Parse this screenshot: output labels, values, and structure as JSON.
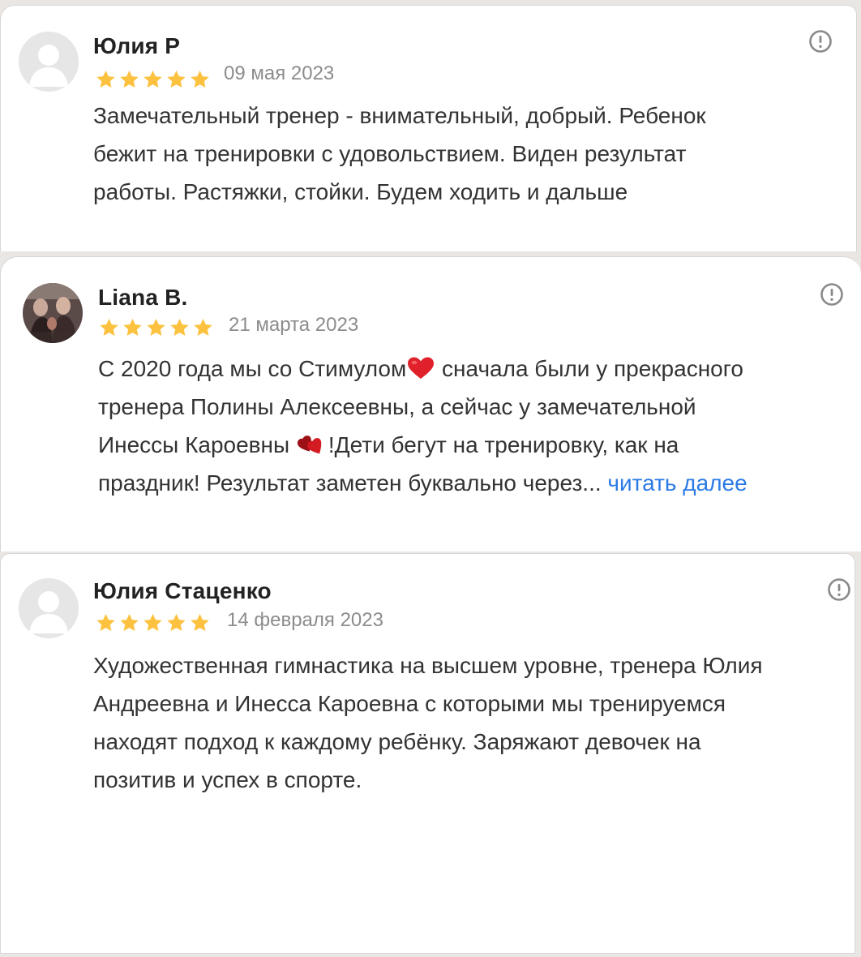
{
  "reviews": [
    {
      "author": "Юлия Р",
      "avatar": "default-avatar-icon",
      "rating": 5,
      "date": "09 мая 2023",
      "text_lines": [
        "Замечательный тренер - внимательный, добрый. Ребенок",
        "бежит на тренировки с удовольствием. Виден результат",
        "работы. Растяжки, стойки. Будем ходить и дальше"
      ]
    },
    {
      "author": "Liana B.",
      "avatar": "user-photo-avatar",
      "rating": 5,
      "date": "21 марта 2023",
      "text_lines": [
        "С 2020 года мы со Стимулом",
        " сначала были у прекрасного",
        "тренера Полины Алексеевны, а сейчас у замечательной",
        "Инессы Кароевны ",
        "!Дети бегут на тренировку, как на",
        "праздник! Результат заметен буквально через..."
      ],
      "read_more": "читать далее"
    },
    {
      "author": "Юлия Стаценко",
      "avatar": "default-avatar-icon",
      "rating": 5,
      "date": "14 февраля 2023",
      "text_lines": [
        "Художественная гимнастика на высшем уровне, тренера Юлия",
        "Андреевна и Инесса Кароевна с которыми мы тренируемся",
        "находят подход к каждому ребёнку. Заряжают девочек на",
        "позитив и успех в спорте."
      ]
    }
  ],
  "colors": {
    "star": "#fcc23f",
    "link": "#2c7be5",
    "date": "#8c8c8c",
    "flag": "#8a8a8a"
  },
  "icons": {
    "report": "exclamation-circle-icon",
    "heart": "red-heart-icon",
    "hearts": "two-hearts-icon"
  }
}
